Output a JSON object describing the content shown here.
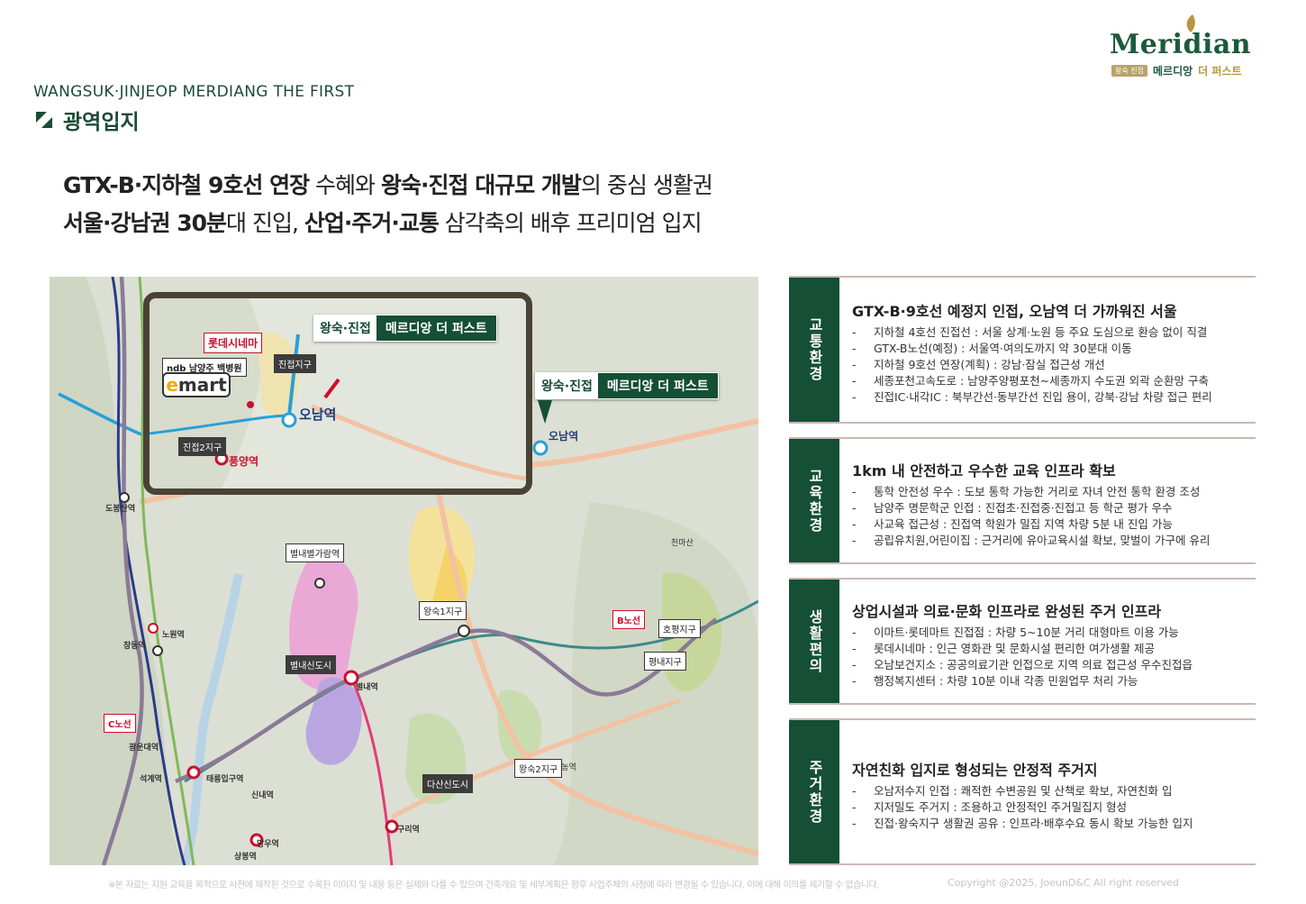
{
  "brand": {
    "logo_word": "Meridian",
    "badge": "왕숙 진접",
    "sub_a": "메르디앙",
    "sub_b": "더 퍼스트"
  },
  "header": {
    "eng_title": "WANGSUK·JINJEOP MERDIANG THE FIRST",
    "section": "광역입지"
  },
  "headline": {
    "line1": [
      {
        "t": "GTX-B·지하철 9호선 연장",
        "b": true
      },
      {
        "t": " 수혜와 ",
        "b": false
      },
      {
        "t": "왕숙·진접 대규모 개발",
        "b": true
      },
      {
        "t": "의 중심 생활권",
        "b": false
      }
    ],
    "line2": [
      {
        "t": "서울·강남권 30분",
        "b": true
      },
      {
        "t": "대 진입, ",
        "b": false
      },
      {
        "t": "산업·주거·교통",
        "b": true
      },
      {
        "t": " 삼각축의 배후 프리미엄 입지",
        "b": false
      }
    ]
  },
  "map": {
    "inset_label_a": "왕숙·진접",
    "inset_label_b": "메르디앙 더 퍼스트",
    "main_label_a": "왕숙·진접",
    "main_label_b": "메르디앙 더 퍼스트",
    "lotte": "롯데시네마",
    "hospital": "ndb 남양주 백병원",
    "emart_e": "e",
    "emart_rest": "mart",
    "jinjeop": "진접지구",
    "jinjeop2": "진접2지구",
    "onam": "오남역",
    "onam_main": "오남역",
    "pungyang": "풍양역",
    "byeollae_dist": "별내신도시",
    "byeollae_station": "별내별가람역",
    "byeollae": "별내역",
    "wangsuk1": "왕숙1지구",
    "wangsuk2": "왕숙2지구",
    "dasan": "다산신도시",
    "hoyp": "호평지구",
    "pyeongnae": "평내지구",
    "gtx_b": "B노선",
    "gtx_c": "C노선",
    "dobong": "도봉산역",
    "nowon": "노원역",
    "changdong": "창동역",
    "guri": "구리역",
    "mangu": "망우역",
    "sangbong": "상봉역",
    "gwangun": "광운대역",
    "seokgye": "석계역",
    "taereung": "태릉입구역",
    "sinnae": "신내역",
    "donong": "도농역",
    "cheonmasan": "천마산"
  },
  "panels": [
    {
      "side": "교통환경",
      "title": "GTX-B·9호선 예정지 인접, 오남역 더 가까워진 서울",
      "items": [
        "지하철 4호선 진접선 : 서울 상계·노원 등 주요 도심으로 환승 없이 직결",
        "GTX-B노선(예정) : 서울역·여의도까지 약 30분대 이동",
        "지하철 9호선 연장(계획) : 강남·잠실 접근성 개선",
        "세종포천고속도로 : 남양주양평포천~세종까지 수도권 외곽 순환망 구축",
        "진접IC·내각IC : 북부간선·동부간선 진입 용이, 강북·강남 차량 접근 편리"
      ]
    },
    {
      "side": "교육환경",
      "title": "1km 내 안전하고 우수한 교육 인프라 확보",
      "items": [
        "통학 안전성 우수 : 도보 통학 가능한 거리로 자녀 안전 통학 환경 조성",
        "남양주 명문학군 인접 : 진접초·진접중·진접고 등 학군 평가 우수",
        "사교육 접근성 : 진접역 학원가 밀집 지역 차량 5분 내 진입 가능",
        "공립유치원,어린이집 : 근거리에 유아교육시설 확보, 맞벌이 가구에 유리"
      ]
    },
    {
      "side": "생활편의",
      "title": "상업시설과 의료·문화 인프라로 완성된 주거 인프라",
      "items": [
        "이마트·롯데마트 진접점 : 차량 5~10분 거리 대형마트 이용 가능",
        "롯데시네마 : 인근 영화관 및 문화시설 편리한 여가생활 제공",
        "오남보건지소 : 공공의료기관 인접으로 지역 의료 접근성 우수진접읍",
        "행정복지센터 : 차량 10분 이내 각종 민원업무 처리 가능"
      ]
    },
    {
      "side": "주거환경",
      "title": "자연친화 입지로 형성되는 안정적 주거지",
      "items": [
        "오남저수지 인접 : 쾌적한 수변공원 및 산책로 확보, 자연친화 입",
        "지저밀도 주거지 : 조용하고 안정적인 주거밀집지 형성",
        "진접·왕숙지구 생활권 공유 : 인프라·배후수요 동시 확보 가능한 입지"
      ]
    }
  ],
  "footer": {
    "note": "※본 자료는 지원 교육을 목적으로 사전에 제작된 것으로 수록된 이미지 및 내용 등은 실제와 다를 수 있으며 건축개요 및 세부계획은 향후 사업주체의 사정에 따라 변경될 수 있습니다. 이에 대해 이의를 제기할 수 없습니다.",
    "copyright": "Copyright @2025, JoeunD&C All right reserved"
  },
  "colors": {
    "brand_green": "#154f36",
    "gold": "#b8963f",
    "line4": "#2a9fd8",
    "gtx": "#8a7a96",
    "panel_border": "#c9b9b3"
  }
}
